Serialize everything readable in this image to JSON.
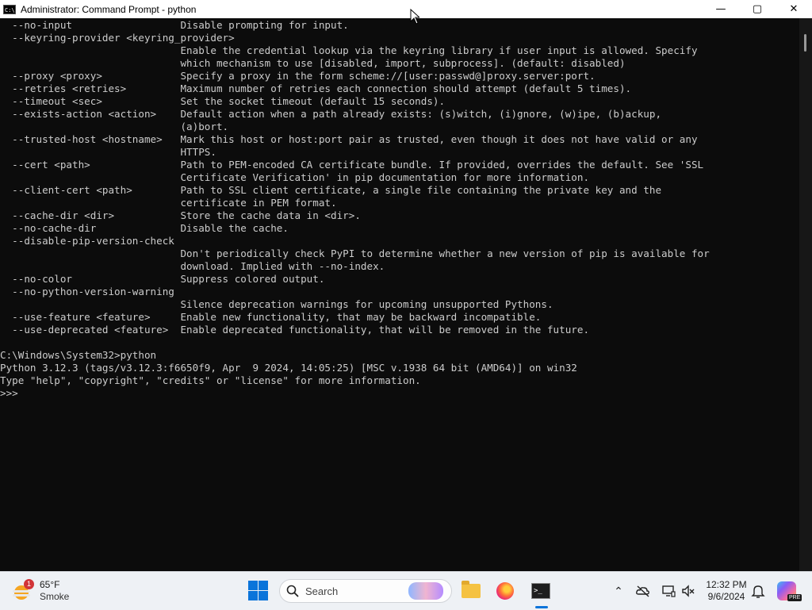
{
  "window": {
    "title": "Administrator: Command Prompt - python",
    "icon_text": "C:\\",
    "controls": {
      "minimize": "—",
      "maximize": "▢",
      "close": "✕"
    }
  },
  "console": {
    "lines": [
      "  --no-input                  Disable prompting for input.",
      "  --keyring-provider <keyring_provider>",
      "                              Enable the credential lookup via the keyring library if user input is allowed. Specify",
      "                              which mechanism to use [disabled, import, subprocess]. (default: disabled)",
      "  --proxy <proxy>             Specify a proxy in the form scheme://[user:passwd@]proxy.server:port.",
      "  --retries <retries>         Maximum number of retries each connection should attempt (default 5 times).",
      "  --timeout <sec>             Set the socket timeout (default 15 seconds).",
      "  --exists-action <action>    Default action when a path already exists: (s)witch, (i)gnore, (w)ipe, (b)ackup,",
      "                              (a)bort.",
      "  --trusted-host <hostname>   Mark this host or host:port pair as trusted, even though it does not have valid or any",
      "                              HTTPS.",
      "  --cert <path>               Path to PEM-encoded CA certificate bundle. If provided, overrides the default. See 'SSL",
      "                              Certificate Verification' in pip documentation for more information.",
      "  --client-cert <path>        Path to SSL client certificate, a single file containing the private key and the",
      "                              certificate in PEM format.",
      "  --cache-dir <dir>           Store the cache data in <dir>.",
      "  --no-cache-dir              Disable the cache.",
      "  --disable-pip-version-check",
      "                              Don't periodically check PyPI to determine whether a new version of pip is available for",
      "                              download. Implied with --no-index.",
      "  --no-color                  Suppress colored output.",
      "  --no-python-version-warning",
      "                              Silence deprecation warnings for upcoming unsupported Pythons.",
      "  --use-feature <feature>     Enable new functionality, that may be backward incompatible.",
      "  --use-deprecated <feature>  Enable deprecated functionality, that will be removed in the future.",
      "",
      "C:\\Windows\\System32>python",
      "Python 3.12.3 (tags/v3.12.3:f6650f9, Apr  9 2024, 14:05:25) [MSC v.1938 64 bit (AMD64)] on win32",
      "Type \"help\", \"copyright\", \"credits\" or \"license\" for more information.",
      ">>> "
    ]
  },
  "taskbar": {
    "weather": {
      "temp": "65°F",
      "condition": "Smoke",
      "badge": "1",
      "icon": "sun-haze-icon"
    },
    "search": {
      "placeholder": "Search"
    },
    "apps": [
      {
        "name": "File Explorer",
        "icon": "folder-icon"
      },
      {
        "name": "Firefox",
        "icon": "firefox-icon"
      },
      {
        "name": "Command Prompt",
        "icon": "cmd-icon",
        "active": true
      }
    ],
    "tray": {
      "chevron": "⌃",
      "clock_time": "12:32 PM",
      "clock_date": "9/6/2024",
      "copilot_badge": "PRE"
    },
    "colors": {
      "accent": "#0a74da",
      "taskbar_bg": "#eef1f5"
    }
  }
}
